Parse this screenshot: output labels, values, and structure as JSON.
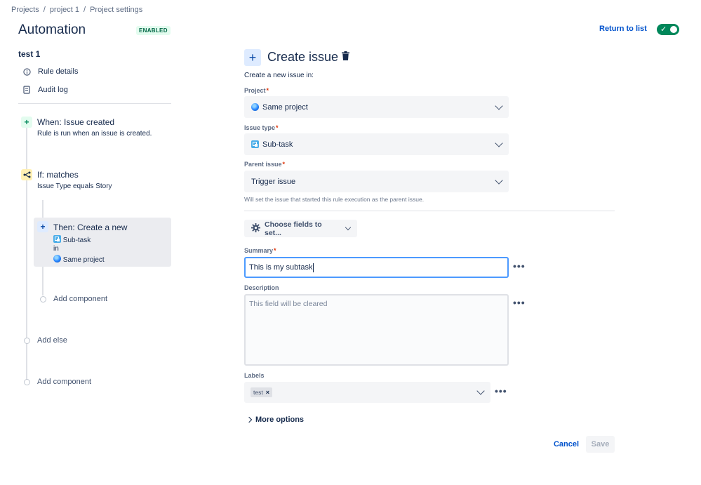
{
  "breadcrumb": [
    "Projects",
    "project 1",
    "Project settings"
  ],
  "header": {
    "title": "Automation",
    "status_badge": "ENABLED",
    "return_link": "Return to list",
    "toggle_on": true
  },
  "sidebar": {
    "rule_name": "test 1",
    "links": [
      {
        "label": "Rule details",
        "icon": "info-icon"
      },
      {
        "label": "Audit log",
        "icon": "document-icon"
      }
    ],
    "trigger": {
      "title": "When: Issue created",
      "subtitle": "Rule is run when an issue is created.",
      "icon": "plus-icon"
    },
    "condition": {
      "title": "If: matches",
      "subtitle": "Issue Type equals Story",
      "icon": "branch-icon"
    },
    "action": {
      "title": "Then: Create a new",
      "line1": "Sub-task",
      "line2": "in",
      "line3": "Same project",
      "icon": "plus-icon"
    },
    "add_component_inner": "Add component",
    "add_else": "Add else",
    "add_component_outer": "Add component"
  },
  "main": {
    "title": "Create issue",
    "intro": "Create a new issue in:",
    "project": {
      "label": "Project",
      "value": "Same project"
    },
    "issue_type": {
      "label": "Issue type",
      "value": "Sub-task"
    },
    "parent_issue": {
      "label": "Parent issue",
      "value": "Trigger issue",
      "hint": "Will set the issue that started this rule execution as the parent issue."
    },
    "choose_fields": "Choose fields to set...",
    "summary": {
      "label": "Summary",
      "value": "This is my subtask"
    },
    "description": {
      "label": "Description",
      "placeholder": "This field will be cleared"
    },
    "labels": {
      "label": "Labels",
      "tags": [
        "test"
      ]
    },
    "more_options": "More options",
    "cancel": "Cancel",
    "save": "Save"
  },
  "colors": {
    "primary": "#0052cc",
    "enabled_green": "#00875a",
    "required_red": "#de350b",
    "condition_yellow": "#fff0b3",
    "trigger_green": "#e3fcef"
  }
}
